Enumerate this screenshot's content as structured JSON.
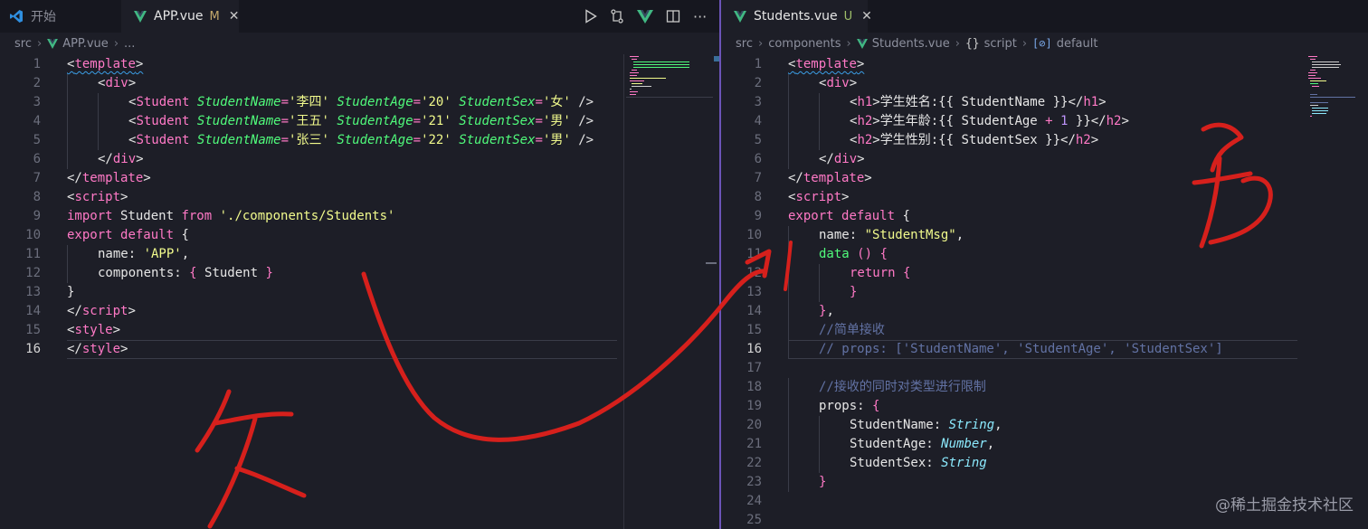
{
  "left": {
    "tabs": [
      {
        "label": "开始",
        "icon": "vscode-logo-icon",
        "state": "inactive"
      },
      {
        "label": "APP.vue",
        "icon": "vue-file-icon",
        "modified": "M",
        "state": "active"
      }
    ],
    "breadcrumb": {
      "folder": "src",
      "file": "APP.vue",
      "more": "..."
    },
    "current_line": 16
  },
  "right": {
    "tabs": [
      {
        "label": "Students.vue",
        "icon": "vue-file-icon",
        "modified": "U",
        "state": "active"
      }
    ],
    "breadcrumb": {
      "folder": "src",
      "subfolder": "components",
      "file": "Students.vue",
      "script_brace": "{}",
      "script": "script",
      "symbol_icon": "[⊘]",
      "symbol": "default"
    },
    "current_line": 16
  },
  "watermark": "@稀土掘金技术社区",
  "colors": {
    "tag": "#ff79c6",
    "attribute": "#50fa7b",
    "string": "#f1fa8c",
    "number": "#bd93f9",
    "type": "#8be9fd",
    "comment": "#6272a4",
    "ink": "#d6201c"
  },
  "editor_left": [
    {
      "n": "1",
      "indent": 0,
      "tokens": [
        [
          "p",
          "<"
        ],
        [
          "t",
          "template"
        ],
        [
          "p",
          ">"
        ]
      ],
      "squiggle": true
    },
    {
      "n": "2",
      "indent": 1,
      "tokens": [
        [
          "p",
          "<"
        ],
        [
          "t",
          "div"
        ],
        [
          "p",
          ">"
        ]
      ]
    },
    {
      "n": "3",
      "indent": 2,
      "tokens": [
        [
          "p",
          "<"
        ],
        [
          "t",
          "Student"
        ],
        [
          "p",
          " "
        ],
        [
          "a",
          "StudentName"
        ],
        [
          "t",
          "="
        ],
        [
          "s",
          "'李四'"
        ],
        [
          "p",
          " "
        ],
        [
          "a",
          "StudentAge"
        ],
        [
          "t",
          "="
        ],
        [
          "s",
          "'20'"
        ],
        [
          "p",
          " "
        ],
        [
          "a",
          "StudentSex"
        ],
        [
          "t",
          "="
        ],
        [
          "s",
          "'女'"
        ],
        [
          "p",
          " />"
        ]
      ]
    },
    {
      "n": "4",
      "indent": 2,
      "tokens": [
        [
          "p",
          "<"
        ],
        [
          "t",
          "Student"
        ],
        [
          "p",
          " "
        ],
        [
          "a",
          "StudentName"
        ],
        [
          "t",
          "="
        ],
        [
          "s",
          "'王五'"
        ],
        [
          "p",
          " "
        ],
        [
          "a",
          "StudentAge"
        ],
        [
          "t",
          "="
        ],
        [
          "s",
          "'21'"
        ],
        [
          "p",
          " "
        ],
        [
          "a",
          "StudentSex"
        ],
        [
          "t",
          "="
        ],
        [
          "s",
          "'男'"
        ],
        [
          "p",
          " />"
        ]
      ]
    },
    {
      "n": "5",
      "indent": 2,
      "tokens": [
        [
          "p",
          "<"
        ],
        [
          "t",
          "Student"
        ],
        [
          "p",
          " "
        ],
        [
          "a",
          "StudentName"
        ],
        [
          "t",
          "="
        ],
        [
          "s",
          "'张三'"
        ],
        [
          "p",
          " "
        ],
        [
          "a",
          "StudentAge"
        ],
        [
          "t",
          "="
        ],
        [
          "s",
          "'22'"
        ],
        [
          "p",
          " "
        ],
        [
          "a",
          "StudentSex"
        ],
        [
          "t",
          "="
        ],
        [
          "s",
          "'男'"
        ],
        [
          "p",
          " />"
        ]
      ]
    },
    {
      "n": "6",
      "indent": 1,
      "tokens": [
        [
          "p",
          "</"
        ],
        [
          "t",
          "div"
        ],
        [
          "p",
          ">"
        ]
      ]
    },
    {
      "n": "7",
      "indent": 0,
      "tokens": [
        [
          "p",
          "</"
        ],
        [
          "t",
          "template"
        ],
        [
          "p",
          ">"
        ]
      ]
    },
    {
      "n": "8",
      "indent": 0,
      "tokens": [
        [
          "p",
          "<"
        ],
        [
          "t",
          "script"
        ],
        [
          "p",
          ">"
        ]
      ]
    },
    {
      "n": "9",
      "indent": 0,
      "tokens": [
        [
          "k",
          "import"
        ],
        [
          "p",
          " Student "
        ],
        [
          "k",
          "from"
        ],
        [
          "p",
          " "
        ],
        [
          "s",
          "'./components/Students'"
        ]
      ]
    },
    {
      "n": "10",
      "indent": 0,
      "tokens": [
        [
          "k",
          "export"
        ],
        [
          "p",
          " "
        ],
        [
          "k",
          "default"
        ],
        [
          "p",
          " {"
        ]
      ]
    },
    {
      "n": "11",
      "indent": 1,
      "tokens": [
        [
          "p",
          "name: "
        ],
        [
          "s",
          "'APP'"
        ],
        [
          "p",
          ","
        ]
      ]
    },
    {
      "n": "12",
      "indent": 1,
      "tokens": [
        [
          "p",
          "components: "
        ],
        [
          "t",
          "{"
        ],
        [
          "p",
          " Student "
        ],
        [
          "t",
          "}"
        ]
      ]
    },
    {
      "n": "13",
      "indent": 0,
      "tokens": [
        [
          "p",
          "}"
        ]
      ]
    },
    {
      "n": "14",
      "indent": 0,
      "tokens": [
        [
          "p",
          "</"
        ],
        [
          "t",
          "script"
        ],
        [
          "p",
          ">"
        ]
      ]
    },
    {
      "n": "15",
      "indent": 0,
      "tokens": [
        [
          "p",
          "<"
        ],
        [
          "t",
          "style"
        ],
        [
          "p",
          ">"
        ]
      ]
    },
    {
      "n": "16",
      "indent": 0,
      "tokens": [
        [
          "p",
          "</"
        ],
        [
          "t",
          "style"
        ],
        [
          "p",
          ">"
        ]
      ]
    }
  ],
  "editor_right": [
    {
      "n": "1",
      "indent": 0,
      "tokens": [
        [
          "p",
          "<"
        ],
        [
          "t",
          "template"
        ],
        [
          "p",
          ">"
        ]
      ],
      "squiggle": true
    },
    {
      "n": "2",
      "indent": 1,
      "tokens": [
        [
          "p",
          "<"
        ],
        [
          "t",
          "div"
        ],
        [
          "p",
          ">"
        ]
      ]
    },
    {
      "n": "3",
      "indent": 2,
      "tokens": [
        [
          "p",
          "<"
        ],
        [
          "t",
          "h1"
        ],
        [
          "p",
          ">学生姓名:{{ StudentName }}</"
        ],
        [
          "t",
          "h1"
        ],
        [
          "p",
          ">"
        ]
      ]
    },
    {
      "n": "4",
      "indent": 2,
      "tokens": [
        [
          "p",
          "<"
        ],
        [
          "t",
          "h2"
        ],
        [
          "p",
          ">学生年龄:{{ StudentAge "
        ],
        [
          "t",
          "+"
        ],
        [
          "p",
          " "
        ],
        [
          "n",
          "1"
        ],
        [
          "p",
          " }}</"
        ],
        [
          "t",
          "h2"
        ],
        [
          "p",
          ">"
        ]
      ]
    },
    {
      "n": "5",
      "indent": 2,
      "tokens": [
        [
          "p",
          "<"
        ],
        [
          "t",
          "h2"
        ],
        [
          "p",
          ">学生性别:{{ StudentSex }}</"
        ],
        [
          "t",
          "h2"
        ],
        [
          "p",
          ">"
        ]
      ]
    },
    {
      "n": "6",
      "indent": 1,
      "tokens": [
        [
          "p",
          "</"
        ],
        [
          "t",
          "div"
        ],
        [
          "p",
          ">"
        ]
      ]
    },
    {
      "n": "7",
      "indent": 0,
      "tokens": [
        [
          "p",
          "</"
        ],
        [
          "t",
          "template"
        ],
        [
          "p",
          ">"
        ]
      ]
    },
    {
      "n": "8",
      "indent": 0,
      "tokens": [
        [
          "p",
          "<"
        ],
        [
          "t",
          "script"
        ],
        [
          "p",
          ">"
        ]
      ]
    },
    {
      "n": "9",
      "indent": 0,
      "tokens": [
        [
          "k",
          "export"
        ],
        [
          "p",
          " "
        ],
        [
          "k",
          "default"
        ],
        [
          "p",
          " {"
        ]
      ]
    },
    {
      "n": "10",
      "indent": 1,
      "tokens": [
        [
          "p",
          "name: "
        ],
        [
          "s",
          "\"StudentMsg\""
        ],
        [
          "p",
          ","
        ]
      ]
    },
    {
      "n": "11",
      "indent": 1,
      "tokens": [
        [
          "f",
          "data"
        ],
        [
          "p",
          " "
        ],
        [
          "t",
          "()"
        ],
        [
          "p",
          " "
        ],
        [
          "t",
          "{"
        ]
      ]
    },
    {
      "n": "12",
      "indent": 2,
      "tokens": [
        [
          "k",
          "return"
        ],
        [
          "p",
          " "
        ],
        [
          "t",
          "{"
        ]
      ]
    },
    {
      "n": "13",
      "indent": 2,
      "tokens": [
        [
          "t",
          "}"
        ]
      ]
    },
    {
      "n": "14",
      "indent": 1,
      "tokens": [
        [
          "t",
          "}"
        ],
        [
          "p",
          ","
        ]
      ]
    },
    {
      "n": "15",
      "indent": 1,
      "tokens": [
        [
          "c",
          "//简单接收"
        ]
      ]
    },
    {
      "n": "16",
      "indent": 1,
      "tokens": [
        [
          "c",
          "// props: ['StudentName', 'StudentAge', 'StudentSex']"
        ]
      ]
    },
    {
      "n": "17",
      "indent": 0,
      "tokens": []
    },
    {
      "n": "18",
      "indent": 1,
      "tokens": [
        [
          "c",
          "//接收的同时对类型进行限制"
        ]
      ]
    },
    {
      "n": "19",
      "indent": 1,
      "tokens": [
        [
          "p",
          "props: "
        ],
        [
          "t",
          "{"
        ]
      ]
    },
    {
      "n": "20",
      "indent": 2,
      "tokens": [
        [
          "p",
          "StudentName: "
        ],
        [
          "ty",
          "String"
        ],
        [
          "p",
          ","
        ]
      ]
    },
    {
      "n": "21",
      "indent": 2,
      "tokens": [
        [
          "p",
          "StudentAge: "
        ],
        [
          "ty",
          "Number"
        ],
        [
          "p",
          ","
        ]
      ]
    },
    {
      "n": "22",
      "indent": 2,
      "tokens": [
        [
          "p",
          "StudentSex: "
        ],
        [
          "ty",
          "String"
        ]
      ]
    },
    {
      "n": "23",
      "indent": 1,
      "tokens": [
        [
          "t",
          "}"
        ]
      ]
    },
    {
      "n": "24",
      "indent": 0,
      "tokens": []
    },
    {
      "n": "25",
      "indent": 0,
      "tokens": []
    }
  ]
}
